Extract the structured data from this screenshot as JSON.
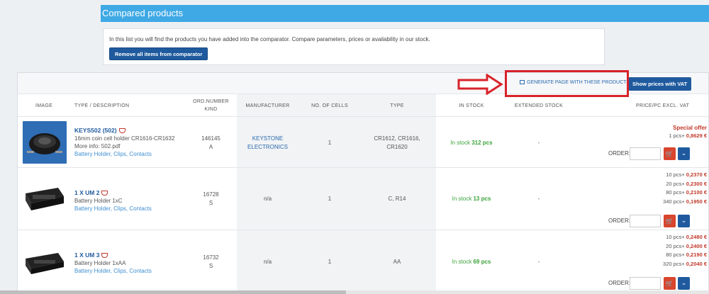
{
  "header": {
    "title": "Compared products"
  },
  "info": {
    "text": "In this list you will find the products you have added into the comparator. Compare parameters, prices or availability in our stock.",
    "remove_label": "Remove all items from comparator"
  },
  "toolbar": {
    "generate_label": "GENERATE PAGE WITH THESE PRODUCTS",
    "vat_label": "Show prices with VAT"
  },
  "columns": {
    "image": "IMAGE",
    "type": "TYPE / DESCRIPTION",
    "ord1": "ORD.NUMBER",
    "ord2": "KIND",
    "manufacturer": "MANUFACTURER",
    "cells": "NO. OF CELLS",
    "type2": "TYPE",
    "stock": "IN STOCK",
    "extended": "EXTENDED STOCK",
    "price": "PRICE/PC EXCL. VAT"
  },
  "order_label": "ORDER:",
  "products": [
    {
      "name": "KEYS502 (502)",
      "desc": "16mm coin cell holder CR1616-CR1632",
      "more": "More info: 502.pdf",
      "category": "Battery Holder, Clips, Contacts",
      "ord_number": "146145",
      "kind": "A",
      "manufacturer1": "KEYSTONE",
      "manufacturer2": "ELECTRONICS",
      "cells": "1",
      "type1": "CR1612, CR1616,",
      "type2": "CR1620",
      "stock_label": "In stock",
      "stock_value": "312 pcs",
      "extended": "-",
      "special": "Special offer",
      "prices": [
        {
          "qty": "1 pcs+",
          "price": "0,8629 €"
        }
      ]
    },
    {
      "name": "1 X UM 2",
      "desc": "Battery Holder 1xC",
      "category": "Battery Holder, Clips, Contacts",
      "ord_number": "16728",
      "kind": "S",
      "manufacturer1": "n/a",
      "cells": "1",
      "type1": "C, R14",
      "stock_label": "In stock",
      "stock_value": "13 pcs",
      "extended": "-",
      "prices": [
        {
          "qty": "10 pcs+",
          "price": "0,2370 €"
        },
        {
          "qty": "20 pcs+",
          "price": "0,2300 €"
        },
        {
          "qty": "80 pcs+",
          "price": "0,2100 €"
        },
        {
          "qty": "340 pcs+",
          "price": "0,1950 €"
        }
      ]
    },
    {
      "name": "1 X UM 3",
      "desc": "Battery Holder 1xAA",
      "category": "Battery Holder, Clips, Contacts",
      "ord_number": "16732",
      "kind": "S",
      "manufacturer1": "n/a",
      "cells": "1",
      "type1": "AA",
      "stock_label": "In stock",
      "stock_value": "69 pcs",
      "extended": "-",
      "prices": [
        {
          "qty": "10 pcs+",
          "price": "0,2480 €"
        },
        {
          "qty": "20 pcs+",
          "price": "0,2400 €"
        },
        {
          "qty": "80 pcs+",
          "price": "0,2190 €"
        },
        {
          "qty": "320 pcs+",
          "price": "0,2040 €"
        }
      ]
    }
  ]
}
